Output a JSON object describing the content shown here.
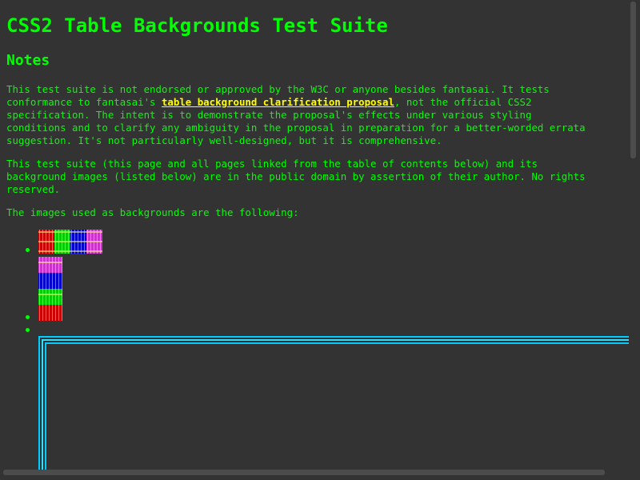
{
  "page": {
    "title": "CSS2 Table Backgrounds Test Suite",
    "notes_heading": "Notes",
    "p1_before": "This test suite is not endorsed or approved by the W3C or anyone besides fantasai. It tests\nconformance to fantasai's ",
    "p1_link": "table background clarification proposal",
    "p1_after": ", not the official CSS2\nspecification. The intent is to demonstrate the proposal's effects under various styling\nconditions and to clarify any ambiguity in the proposal in preparation for a better-worded errata\nsuggestion. It's not particularly well-designed, but it is comprehensive.",
    "p2": "This test suite (this page and all pages linked from the table of contents below) and its\nbackground images (listed below) are in the public domain by assertion of their author. No rights\nreserved.",
    "p3": "The images used as backgrounds are the following:"
  },
  "colors": {
    "background": "#333333",
    "text": "#00ff00",
    "link": "#ffff00",
    "border_cyan": "#00ccff"
  },
  "images": [
    {
      "name": "horizontal-stripes-image",
      "palette": [
        "#cc0000",
        "#00cc00",
        "#0000cc",
        "#cc33cc"
      ]
    },
    {
      "name": "vertical-stripes-image",
      "palette": [
        "#cc33cc",
        "#0000cc",
        "#00cc00",
        "#cc0000"
      ]
    },
    {
      "name": "cyan-border-image",
      "palette": [
        "#00ccff"
      ]
    }
  ]
}
